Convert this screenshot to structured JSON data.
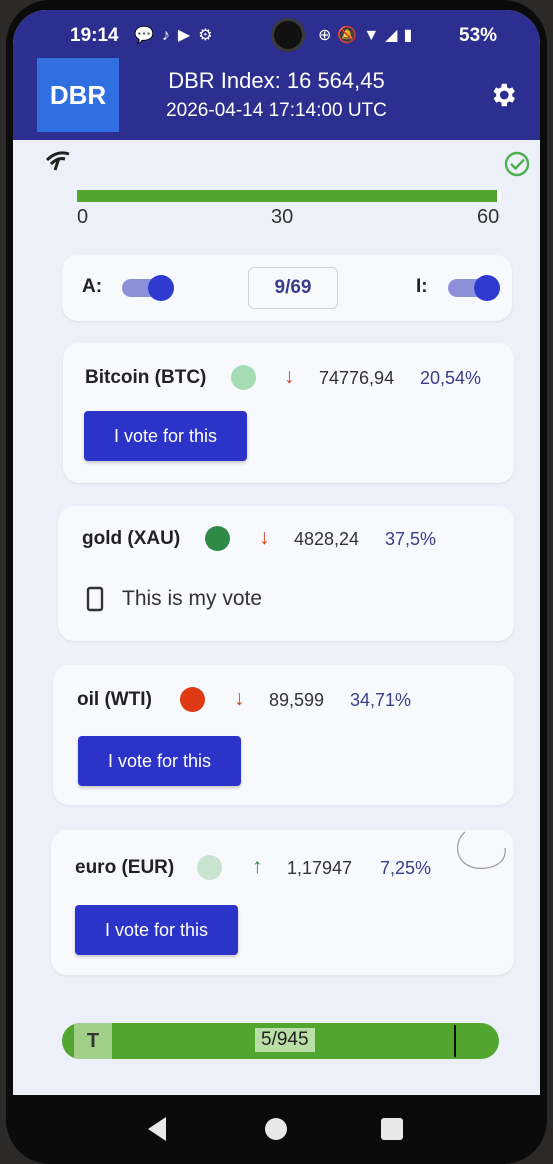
{
  "status_bar": {
    "time": "19:14",
    "left_icons": [
      "chat-icon",
      "tiktok-icon",
      "youtube-icon",
      "gear-icon"
    ],
    "right_icons": [
      "data-saver-icon",
      "mute-icon",
      "wifi-icon",
      "signal-icon",
      "battery-icon"
    ],
    "battery": "53%"
  },
  "app_bar": {
    "logo": "DBR",
    "index_title": "DBR Index: 16 564,45",
    "timestamp": "2026-04-14 17:14:00 UTC",
    "settings_icon": "gear-icon"
  },
  "progress": {
    "fraction": 0.99,
    "ticks": [
      "0",
      "30",
      "60"
    ],
    "fill_color": "#52a52f"
  },
  "controls": {
    "a_label": "A:",
    "a_on": true,
    "counter": "9/69",
    "i_label": "I:",
    "i_on": true
  },
  "assets": [
    {
      "name": "Bitcoin (BTC)",
      "dot_color": "#a6dcb4",
      "trend": "down",
      "price": "74776,94",
      "share": "20,54%",
      "button": "I vote for this"
    },
    {
      "name": "gold (XAU)",
      "dot_color": "#2e8b45",
      "trend": "down",
      "price": "4828,24",
      "share": "37,5%",
      "my_vote": "This is my vote"
    },
    {
      "name": "oil (WTI)",
      "dot_color": "#e03a14",
      "trend": "down",
      "price": "89,599",
      "share": "34,71%",
      "button": "I vote for this"
    },
    {
      "name": "euro (EUR)",
      "dot_color": "#c8e3cf",
      "trend": "up",
      "price": "1,17947",
      "share": "7,25%",
      "button": "I vote for this"
    }
  ],
  "trend_glyphs": {
    "down": "↓",
    "up": "↑"
  },
  "bottom_bar": {
    "label": "T",
    "count": "5/945",
    "fill_color": "#52a52f"
  }
}
